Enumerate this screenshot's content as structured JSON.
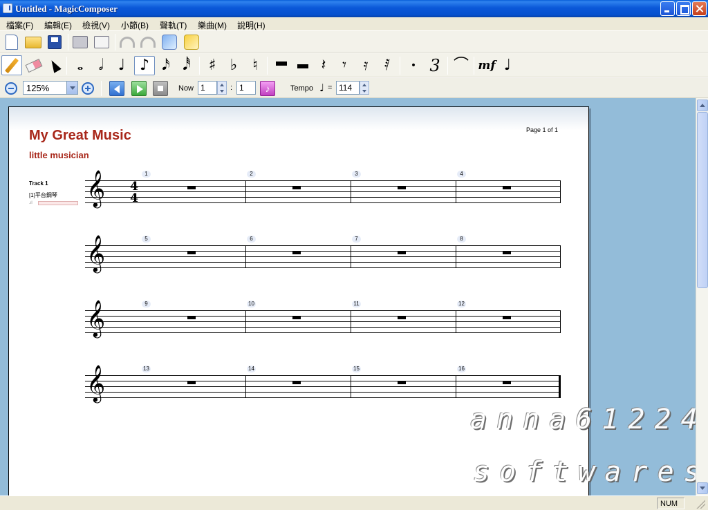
{
  "window": {
    "title": "Untitled - MagicComposer"
  },
  "menu": {
    "items": [
      "檔案(F)",
      "編輯(E)",
      "檢視(V)",
      "小節(B)",
      "聲軌(T)",
      "樂曲(M)",
      "說明(H)"
    ]
  },
  "toolbar_icons": [
    "new-document-icon",
    "open-folder-icon",
    "save-icon",
    "print-icon",
    "print-preview-icon",
    "undo-icon",
    "redo-icon",
    "music-lib-icon",
    "score-settings-icon"
  ],
  "note_toolbar": {
    "tools": [
      "pencil-icon",
      "eraser-icon",
      "select-arrow-icon"
    ],
    "notes": [
      {
        "name": "whole-note",
        "glyph": "𝅝"
      },
      {
        "name": "half-note",
        "glyph": "𝅗𝅥"
      },
      {
        "name": "quarter-note",
        "glyph": "♩"
      },
      {
        "name": "eighth-note",
        "glyph": "♪"
      },
      {
        "name": "sixteenth-note",
        "glyph": "𝅘𝅥𝅯"
      },
      {
        "name": "thirty-second-note",
        "glyph": "𝅘𝅥𝅰"
      }
    ],
    "accidentals": [
      {
        "name": "sharp",
        "glyph": "♯"
      },
      {
        "name": "flat",
        "glyph": "♭"
      },
      {
        "name": "natural",
        "glyph": "♮"
      }
    ],
    "rests": [
      {
        "name": "quarter-rest",
        "glyph": "𝄽"
      },
      {
        "name": "eighth-rest",
        "glyph": "𝄾"
      },
      {
        "name": "sixteenth-rest",
        "glyph": "𝄿"
      },
      {
        "name": "thirty-second-rest",
        "glyph": "𝅀"
      }
    ],
    "dot_glyph": "•",
    "triplet_glyph": "3",
    "slur_glyph": "⌒",
    "dynamics_label": "mf"
  },
  "playback": {
    "zoom": "125%",
    "now_label": "Now",
    "now_measure": "1",
    "colon": ":",
    "now_beat": "1",
    "metronome_glyph": "♪",
    "tempo_label": "Tempo",
    "tempo_note_glyph": "♩",
    "tempo_equals": "=",
    "tempo_value": "114"
  },
  "score": {
    "title": "My Great Music",
    "subtitle": "little musician",
    "page_label": "Page 1 of 1",
    "track_name": "Track 1",
    "instrument": "[1]平台鋼琴",
    "volume_mark": ".ıl",
    "clef_glyph": "𝄞",
    "time_sig_top": "4",
    "time_sig_bottom": "4",
    "measures": [
      "1",
      "2",
      "3",
      "4",
      "5",
      "6",
      "7",
      "8",
      "9",
      "10",
      "11",
      "12",
      "13",
      "14",
      "15",
      "16"
    ]
  },
  "watermark": {
    "line1": "anna61224",
    "line2": "softwares"
  },
  "status": {
    "num": "NUM"
  }
}
